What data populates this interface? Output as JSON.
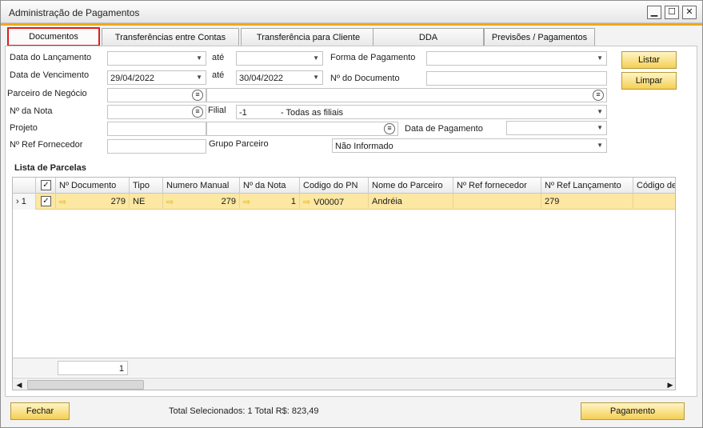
{
  "window": {
    "title": "Administração de Pagamentos"
  },
  "tabs": [
    {
      "label": "Documentos"
    },
    {
      "label": "Transferências entre Contas"
    },
    {
      "label": "Transferência para Cliente"
    },
    {
      "label": "DDA"
    },
    {
      "label": "Previsões / Pagamentos"
    }
  ],
  "filters": {
    "data_lancamento_label": "Data do Lançamento",
    "ate1_label": "até",
    "forma_pagamento_label": "Forma de Pagamento",
    "data_vencimento_label": "Data de Vencimento",
    "data_vencimento_from": "29/04/2022",
    "ate2_label": "até",
    "data_vencimento_to": "30/04/2022",
    "num_documento_label": "Nº do Documento",
    "parceiro_label": "Parceiro de Negócio",
    "num_nota_label": "Nº da Nota",
    "filial_label": "Filial",
    "filial_code": "-1",
    "filial_name": "- Todas as filiais",
    "projeto_label": "Projeto",
    "data_pagamento_label": "Data de Pagamento",
    "num_ref_fornecedor_label": "Nº Ref Fornecedor",
    "grupo_parceiro_label": "Grupo Parceiro",
    "grupo_parceiro_value": "Não Informado"
  },
  "buttons": {
    "listar": "Listar",
    "limpar": "Limpar",
    "fechar": "Fechar",
    "pagamento": "Pagamento"
  },
  "grid": {
    "title": "Lista de Parcelas",
    "columns": [
      "Nº Documento",
      "Tipo",
      "Numero Manual",
      "Nº da Nota",
      "Codigo do PN",
      "Nome do Parceiro",
      "Nº Ref fornecedor",
      "Nº Ref Lançamento",
      "Código de"
    ],
    "rows": [
      {
        "row_num": "1",
        "doc": "279",
        "tipo": "NE",
        "numero_manual": "279",
        "nota": "1",
        "codigo_pn": "V00007",
        "nome": "Andréia",
        "ref_fornecedor": "",
        "ref_lancamento": "279",
        "codigo": ""
      }
    ],
    "footer_count": "1"
  },
  "status": {
    "total": "Total Selecionados: 1 Total R$: 823,49"
  }
}
